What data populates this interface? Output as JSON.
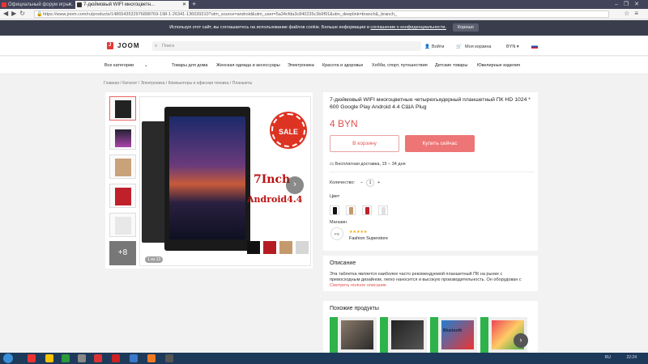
{
  "browser": {
    "tabs": [
      {
        "label": "Официальный форум игры..."
      },
      {
        "label": "7-дюймовый WIFI многоцветн..."
      }
    ],
    "url": "https://www.joom.com/ru/products/1486543532976898769-198-1-26341-136039310?utm_source=android&utm_user=5a34cfda3c840235c3b9f91&utm_deeplink=branch&_branch_"
  },
  "cookie": {
    "text": "Используя этот сайт, вы соглашаетесь на использование файлов cookie. Больше информации в",
    "link": "соглашении о конфиденциальности.",
    "ok_label": "Хорошо"
  },
  "header": {
    "logo": "JOOM",
    "search_placeholder": "Поиск",
    "login": "Войти",
    "cart": "Моя корзина",
    "currency": "BYN ▾"
  },
  "categories": {
    "all": "Все категории",
    "items": [
      "Товары для дома",
      "Женская одежда и аксессуары",
      "Электроника",
      "Красота и здоровье",
      "Хобби, спорт, путешествия",
      "Детские товары",
      "Ювелирные изделия"
    ]
  },
  "breadcrumbs": [
    "Главная",
    "Каталог",
    "Электроника",
    "Компьютеры и офисная техника",
    "Планшеты"
  ],
  "gallery": {
    "sale": "SALE",
    "promo_line1": "7Inch",
    "promo_line2": "Android4.4",
    "counter": "1 из 13",
    "more": "+8"
  },
  "product": {
    "title": "7-дюймовый WIFI многоцветные четырехъядерный планшетный ПК HD 1024 * 600 Google Play Android 4.4 США Plug",
    "price": "4 BYN",
    "add_to_cart": "В корзину",
    "buy_now": "Купить сейчас",
    "delivery": "Бесплатная доставка, 15 – 34 дня",
    "quantity_label": "Количество:",
    "quantity": "1",
    "color_label": "Цвет",
    "store_label": "Магазин",
    "store_avatar": "FS",
    "store_rating": "★★★★★",
    "store_name": "Fashion Superstore"
  },
  "description": {
    "heading": "Описание",
    "text": "Эта таблетка является наиболее часто рекомендуемой планшетный ПК на рынке с превосходным дизайном, легко наносится и высокую производительность. Он оборудован с",
    "show_all": "Смотреть полное описание"
  },
  "similar": {
    "heading": "Похожие продукты",
    "bluetooth_label": "Bluetooth"
  },
  "taskbar": {
    "lang": "RU",
    "time": "22:24"
  },
  "colors": {
    "accent": "#e05353",
    "buy_button": "#ee7575",
    "header_dark": "#3a3d4c"
  }
}
